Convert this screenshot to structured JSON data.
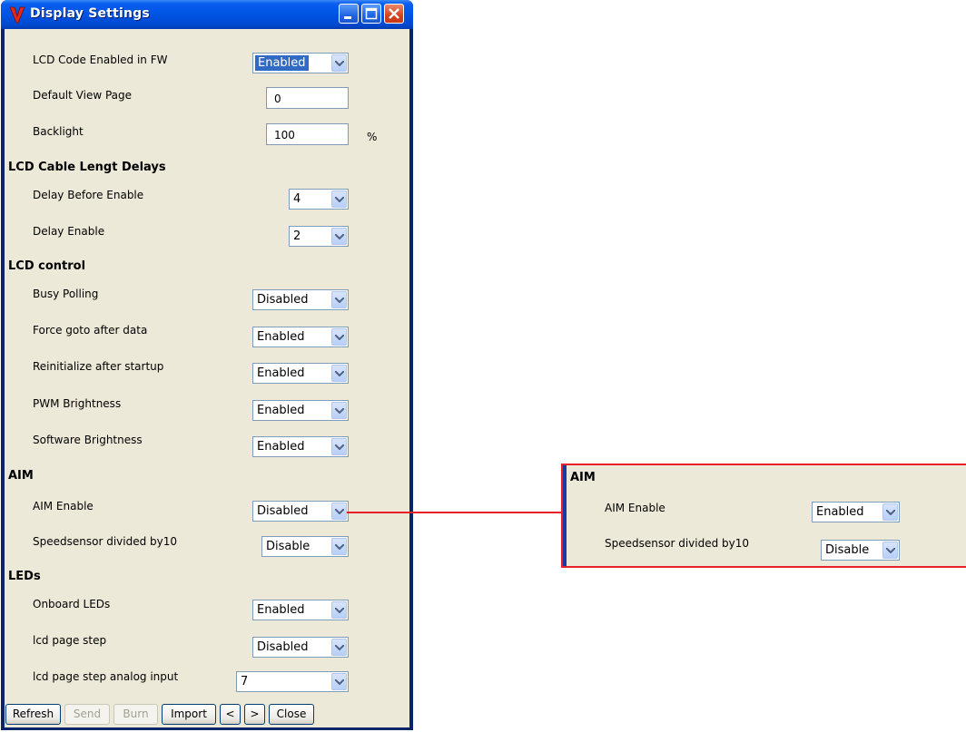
{
  "window": {
    "title": "Display Settings"
  },
  "settings": {
    "lcd_code_enabled": {
      "label": "LCD Code Enabled in FW",
      "value": "Enabled"
    },
    "default_view_page": {
      "label": "Default View Page",
      "value": "0"
    },
    "backlight": {
      "label": "Backlight",
      "value": "100",
      "unit": "%"
    }
  },
  "cable_delays": {
    "heading": "LCD Cable Lengt Delays",
    "delay_before_enable": {
      "label": "Delay Before Enable",
      "value": "4"
    },
    "delay_enable": {
      "label": "Delay Enable",
      "value": "2"
    }
  },
  "lcd_control": {
    "heading": "LCD control",
    "busy_polling": {
      "label": "Busy Polling",
      "value": "Disabled"
    },
    "force_goto": {
      "label": "Force goto after data",
      "value": "Enabled"
    },
    "reinitialize": {
      "label": "Reinitialize after startup",
      "value": "Enabled"
    },
    "pwm_brightness": {
      "label": "PWM Brightness",
      "value": "Enabled"
    },
    "software_brightness": {
      "label": "Software Brightness",
      "value": "Enabled"
    }
  },
  "aim": {
    "heading": "AIM",
    "aim_enable": {
      "label": "AIM Enable",
      "value": "Disabled"
    },
    "speedsensor": {
      "label": "Speedsensor divided by10",
      "value": "Disable"
    }
  },
  "leds": {
    "heading": "LEDs",
    "onboard": {
      "label": "Onboard LEDs",
      "value": "Enabled"
    },
    "page_step": {
      "label": "lcd page step",
      "value": "Disabled"
    },
    "page_step_analog": {
      "label": "lcd page step analog input",
      "value": "7"
    }
  },
  "buttons": {
    "refresh": "Refresh",
    "send": "Send",
    "burn": "Burn",
    "import": "Import",
    "prev": "<",
    "next": ">",
    "close": "Close"
  },
  "callout": {
    "heading": "AIM",
    "aim_enable": {
      "label": "AIM Enable",
      "value": "Enabled"
    },
    "speedsensor": {
      "label": "Speedsensor divided by10",
      "value": "Disable"
    }
  },
  "colors": {
    "titlebar": "#0054e3",
    "dialog_bg": "#ece9d8",
    "callout_border": "#e8202a",
    "selection": "#316ac5"
  }
}
